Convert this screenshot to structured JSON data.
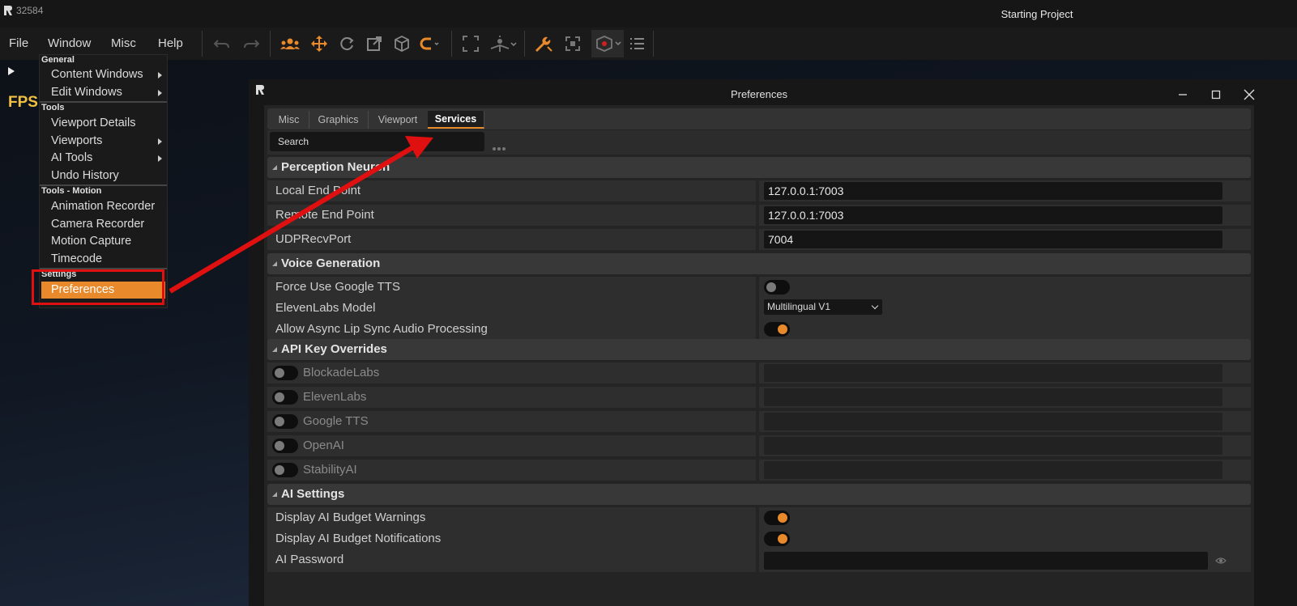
{
  "titlebar": {
    "pid": "32584",
    "project_title": "Starting Project"
  },
  "menubar": {
    "items": [
      "File",
      "Window",
      "Misc",
      "Help"
    ]
  },
  "viewport": {
    "fps_label": "FPS"
  },
  "window_menu": {
    "sections": [
      "General",
      "Tools",
      "Tools - Motion",
      "Settings"
    ],
    "items": [
      "Content Windows",
      "Edit Windows",
      "Viewport Details",
      "Viewports",
      "AI Tools",
      "Undo History",
      "Animation Recorder",
      "Camera Recorder",
      "Motion Capture",
      "Timecode",
      "Preferences"
    ]
  },
  "preferences": {
    "title": "Preferences",
    "tabs": [
      "Misc",
      "Graphics",
      "Viewport",
      "Services"
    ],
    "active_tab": "Services",
    "search_placeholder": "Search",
    "categories": [
      "Perception Neuron",
      "Voice Generation",
      "API Key Overrides",
      "AI Settings"
    ],
    "perception": [
      {
        "label": "Local End Point",
        "value": "127.0.0.1:7003"
      },
      {
        "label": "Remote End Point",
        "value": "127.0.0.1:7003"
      },
      {
        "label": "UDPRecvPort",
        "value": "7004"
      }
    ],
    "voice": {
      "force_google_label": "Force Use Google TTS",
      "force_google_on": false,
      "elevenlabs_model_label": "ElevenLabs Model",
      "elevenlabs_model_value": "Multilingual V1",
      "async_lipsync_label": "Allow Async Lip Sync Audio Processing",
      "async_lipsync_on": true
    },
    "api_keys": [
      "BlockadeLabs",
      "ElevenLabs",
      "Google TTS",
      "OpenAI",
      "StabilityAI"
    ],
    "ai_settings": {
      "budget_warnings_label": "Display AI Budget Warnings",
      "budget_notifications_label": "Display AI Budget Notifications",
      "password_label": "AI Password"
    }
  },
  "colors": {
    "accent": "#e8892b",
    "annotation_red": "#e01010"
  }
}
